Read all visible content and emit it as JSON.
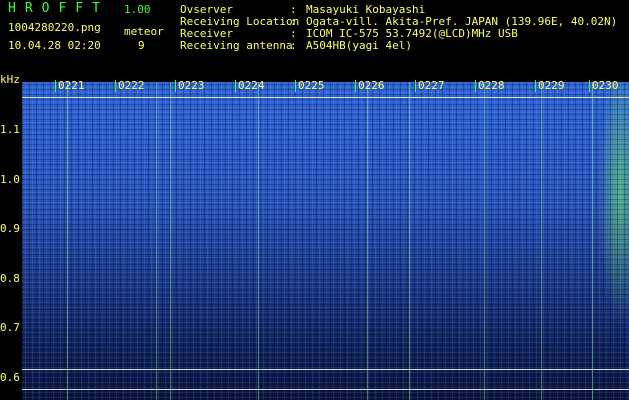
{
  "header": {
    "app_title": "HROFFT",
    "app_version": "1.00",
    "file_name": "1004280220.png",
    "meteor_label": "meteor",
    "datetime": "10.04.28 02:20",
    "meteor_count": "9"
  },
  "info": {
    "observer_label": "Ovserver",
    "observer_value": "Masayuki Kobayashi",
    "location_label": "Receiving Location",
    "location_value": "Ogata-vill. Akita-Pref. JAPAN (139.96E, 40.02N)",
    "receiver_label": "Receiver",
    "receiver_value": "ICOM IC-575 53.7492(@LCD)MHz USB",
    "antenna_label": "Receiving antenna",
    "antenna_value": "A504HB(yagi 4el)",
    "separator": ":"
  },
  "axis": {
    "unit": "kHz",
    "ticks": [
      "1.1",
      "1.0",
      "0.9",
      "0.8",
      "0.7",
      "0.6"
    ]
  },
  "time_markers": [
    "0221",
    "0222",
    "0223",
    "0224",
    "0225",
    "0226",
    "0227",
    "0228",
    "0229",
    "0230"
  ],
  "colors": {
    "text": "#ffff66",
    "accent": "#39ff39",
    "background": "#000000"
  }
}
